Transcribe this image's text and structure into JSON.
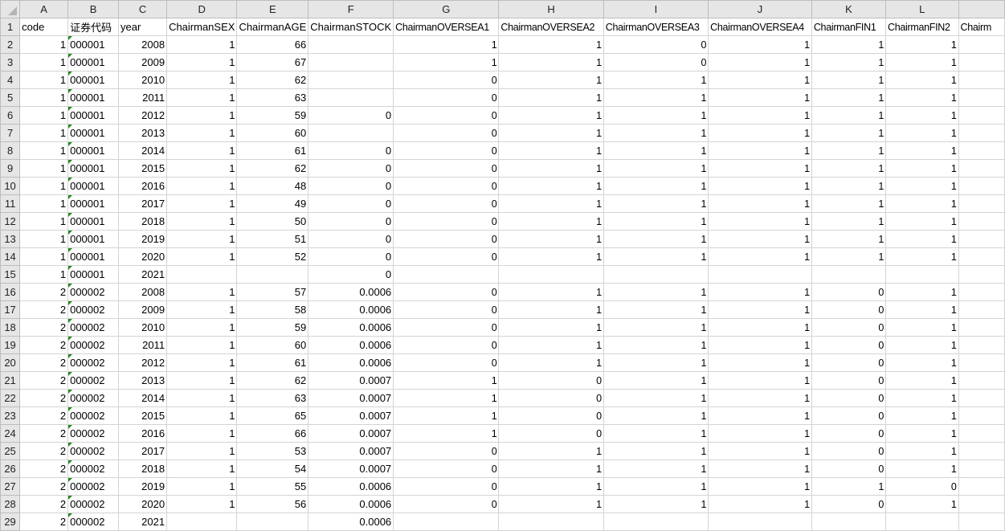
{
  "column_letters": [
    "A",
    "B",
    "C",
    "D",
    "E",
    "F",
    "G",
    "H",
    "I",
    "J",
    "K",
    "L",
    ""
  ],
  "headers": [
    "code",
    "证券代码",
    "year",
    "ChairmanSEX",
    "ChairmanAGE",
    "ChairmanSTOCK",
    "ChairmanOVERSEA1",
    "ChairmanOVERSEA2",
    "ChairmanOVERSEA3",
    "ChairmanOVERSEA4",
    "ChairmanFIN1",
    "ChairmanFIN2",
    "Chairm"
  ],
  "rows": [
    [
      "1",
      "000001",
      "2008",
      "1",
      "66",
      "",
      "1",
      "1",
      "0",
      "1",
      "1",
      "1",
      ""
    ],
    [
      "1",
      "000001",
      "2009",
      "1",
      "67",
      "",
      "1",
      "1",
      "0",
      "1",
      "1",
      "1",
      ""
    ],
    [
      "1",
      "000001",
      "2010",
      "1",
      "62",
      "",
      "0",
      "1",
      "1",
      "1",
      "1",
      "1",
      ""
    ],
    [
      "1",
      "000001",
      "2011",
      "1",
      "63",
      "",
      "0",
      "1",
      "1",
      "1",
      "1",
      "1",
      ""
    ],
    [
      "1",
      "000001",
      "2012",
      "1",
      "59",
      "0",
      "0",
      "1",
      "1",
      "1",
      "1",
      "1",
      ""
    ],
    [
      "1",
      "000001",
      "2013",
      "1",
      "60",
      "",
      "0",
      "1",
      "1",
      "1",
      "1",
      "1",
      ""
    ],
    [
      "1",
      "000001",
      "2014",
      "1",
      "61",
      "0",
      "0",
      "1",
      "1",
      "1",
      "1",
      "1",
      ""
    ],
    [
      "1",
      "000001",
      "2015",
      "1",
      "62",
      "0",
      "0",
      "1",
      "1",
      "1",
      "1",
      "1",
      ""
    ],
    [
      "1",
      "000001",
      "2016",
      "1",
      "48",
      "0",
      "0",
      "1",
      "1",
      "1",
      "1",
      "1",
      ""
    ],
    [
      "1",
      "000001",
      "2017",
      "1",
      "49",
      "0",
      "0",
      "1",
      "1",
      "1",
      "1",
      "1",
      ""
    ],
    [
      "1",
      "000001",
      "2018",
      "1",
      "50",
      "0",
      "0",
      "1",
      "1",
      "1",
      "1",
      "1",
      ""
    ],
    [
      "1",
      "000001",
      "2019",
      "1",
      "51",
      "0",
      "0",
      "1",
      "1",
      "1",
      "1",
      "1",
      ""
    ],
    [
      "1",
      "000001",
      "2020",
      "1",
      "52",
      "0",
      "0",
      "1",
      "1",
      "1",
      "1",
      "1",
      ""
    ],
    [
      "1",
      "000001",
      "2021",
      "",
      "",
      "0",
      "",
      "",
      "",
      "",
      "",
      "",
      ""
    ],
    [
      "2",
      "000002",
      "2008",
      "1",
      "57",
      "0.0006",
      "0",
      "1",
      "1",
      "1",
      "0",
      "1",
      ""
    ],
    [
      "2",
      "000002",
      "2009",
      "1",
      "58",
      "0.0006",
      "0",
      "1",
      "1",
      "1",
      "0",
      "1",
      ""
    ],
    [
      "2",
      "000002",
      "2010",
      "1",
      "59",
      "0.0006",
      "0",
      "1",
      "1",
      "1",
      "0",
      "1",
      ""
    ],
    [
      "2",
      "000002",
      "2011",
      "1",
      "60",
      "0.0006",
      "0",
      "1",
      "1",
      "1",
      "0",
      "1",
      ""
    ],
    [
      "2",
      "000002",
      "2012",
      "1",
      "61",
      "0.0006",
      "0",
      "1",
      "1",
      "1",
      "0",
      "1",
      ""
    ],
    [
      "2",
      "000002",
      "2013",
      "1",
      "62",
      "0.0007",
      "1",
      "0",
      "1",
      "1",
      "0",
      "1",
      ""
    ],
    [
      "2",
      "000002",
      "2014",
      "1",
      "63",
      "0.0007",
      "1",
      "0",
      "1",
      "1",
      "0",
      "1",
      ""
    ],
    [
      "2",
      "000002",
      "2015",
      "1",
      "65",
      "0.0007",
      "1",
      "0",
      "1",
      "1",
      "0",
      "1",
      ""
    ],
    [
      "2",
      "000002",
      "2016",
      "1",
      "66",
      "0.0007",
      "1",
      "0",
      "1",
      "1",
      "0",
      "1",
      ""
    ],
    [
      "2",
      "000002",
      "2017",
      "1",
      "53",
      "0.0007",
      "0",
      "1",
      "1",
      "1",
      "0",
      "1",
      ""
    ],
    [
      "2",
      "000002",
      "2018",
      "1",
      "54",
      "0.0007",
      "0",
      "1",
      "1",
      "1",
      "0",
      "1",
      ""
    ],
    [
      "2",
      "000002",
      "2019",
      "1",
      "55",
      "0.0006",
      "0",
      "1",
      "1",
      "1",
      "1",
      "0",
      ""
    ],
    [
      "2",
      "000002",
      "2020",
      "1",
      "56",
      "0.0006",
      "0",
      "1",
      "1",
      "1",
      "0",
      "1",
      ""
    ],
    [
      "2",
      "000002",
      "2021",
      "",
      "",
      "0.0006",
      "",
      "",
      "",
      "",
      "",
      "",
      ""
    ]
  ],
  "colors": {
    "text_indicator": "#1e8a1e",
    "grid": "#d4d4d4",
    "header_bg": "#e6e6e6"
  }
}
